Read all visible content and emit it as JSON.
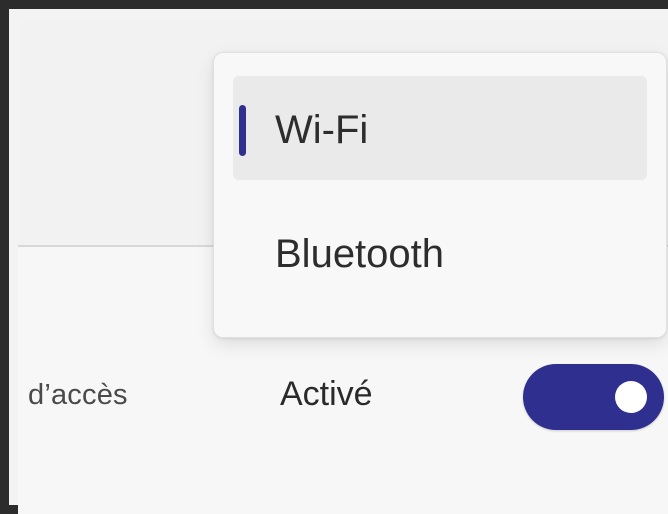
{
  "menu": {
    "items": [
      {
        "label": "Wi-Fi",
        "selected": true
      },
      {
        "label": "Bluetooth",
        "selected": false
      }
    ]
  },
  "row": {
    "partial_label": "d’accès",
    "status": "Activé"
  },
  "toggle": {
    "state": "on"
  },
  "colors": {
    "accent": "#2f2f8f",
    "menu_background": "#f8f8f8",
    "selected_item_background": "#eaeaea"
  },
  "icons": {
    "selection_indicator": "vertical-bar-indicator"
  }
}
